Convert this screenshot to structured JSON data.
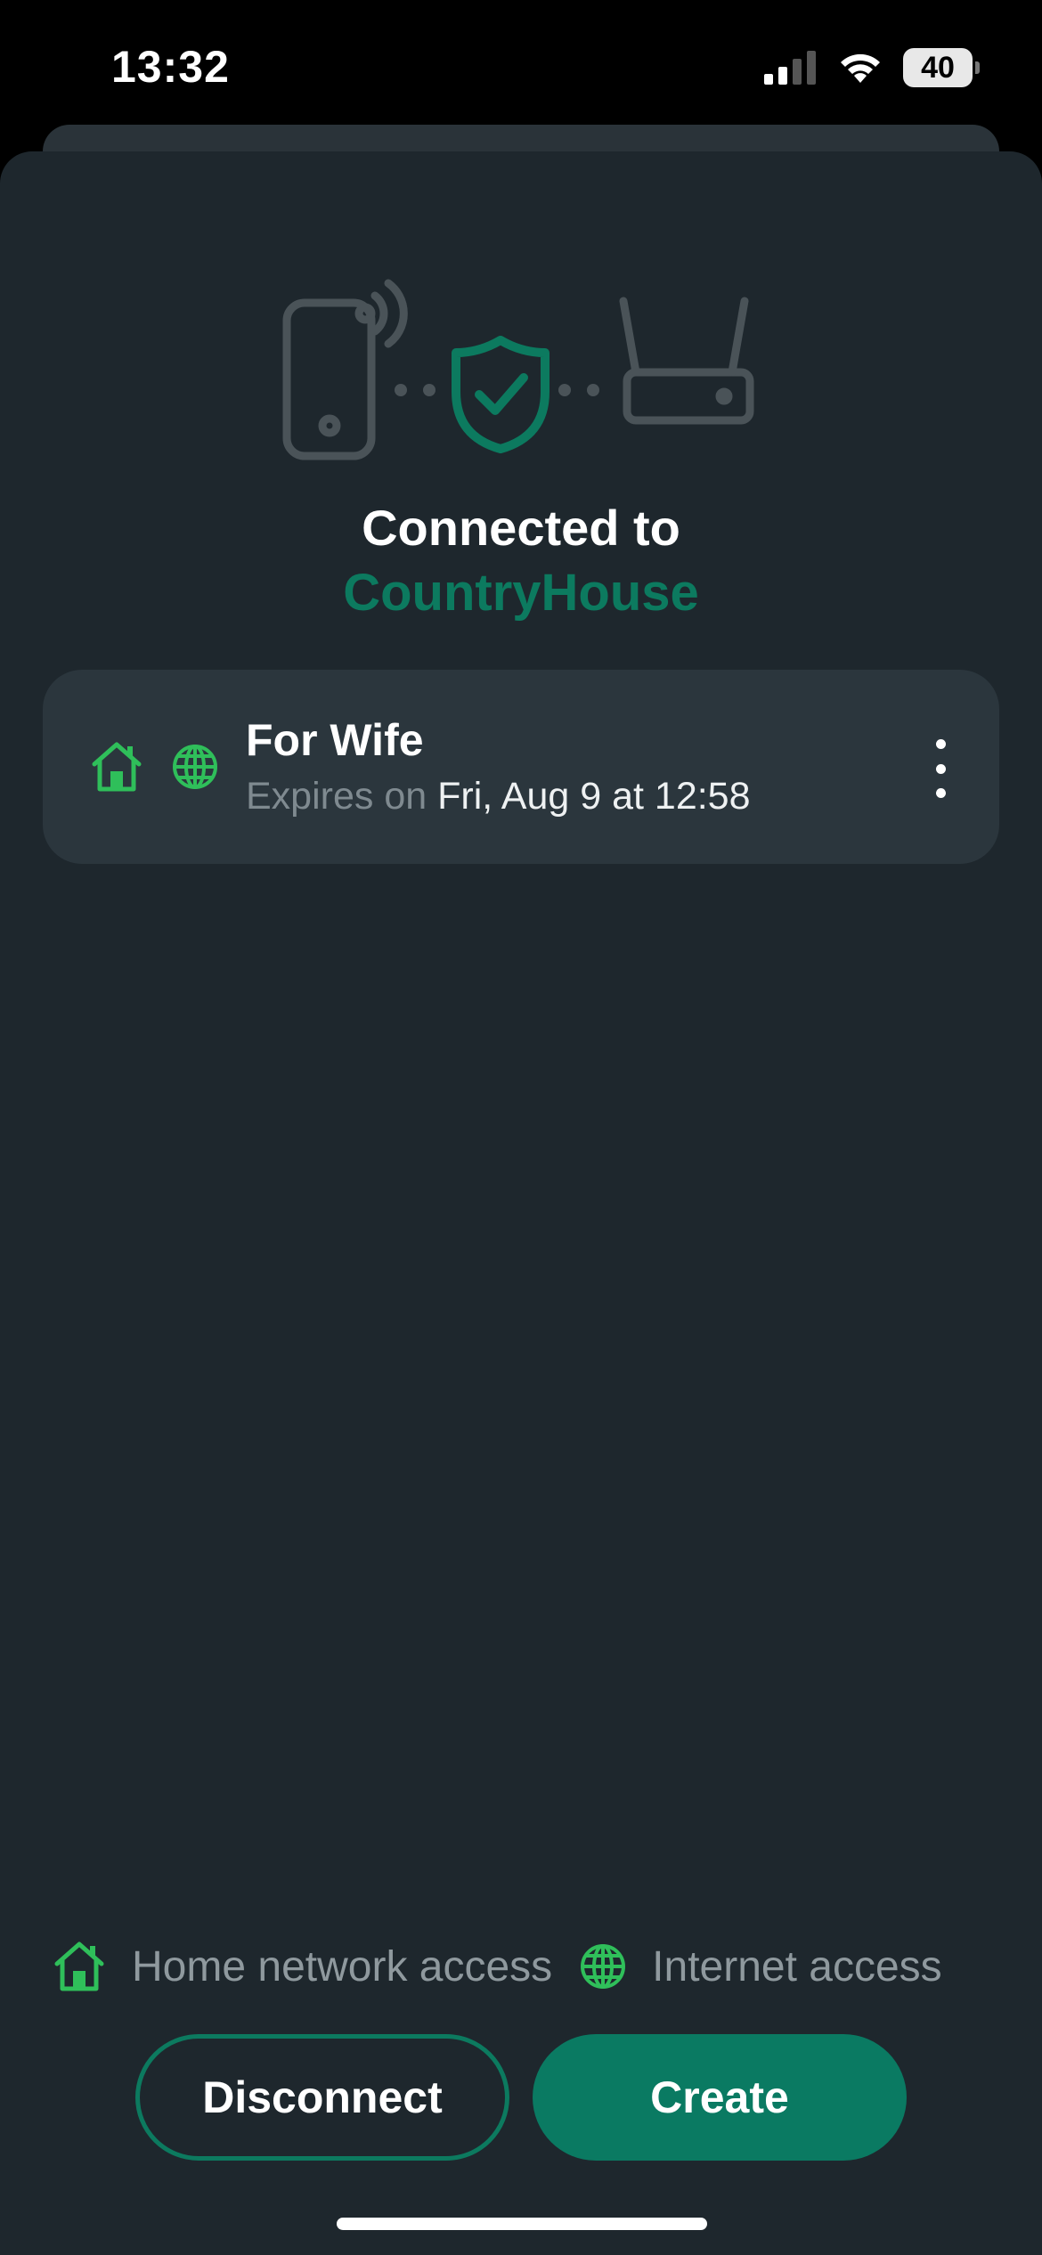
{
  "status_bar": {
    "time": "13:32",
    "battery": "40",
    "icons": [
      "cellular-signal-icon",
      "wifi-icon",
      "battery-icon"
    ]
  },
  "header": {
    "illustration_icons": [
      "phone-signal-icon",
      "shield-check-icon",
      "router-icon"
    ],
    "title": "Connected to",
    "network_name": "CountryHouse"
  },
  "invites": [
    {
      "name": "For Wife",
      "expires_prefix": "Expires on",
      "expires_value": "Fri, Aug 9 at 12:58",
      "icons": [
        "home-icon",
        "globe-icon"
      ],
      "menu_icon": "more-vertical-icon"
    }
  ],
  "legend": {
    "home_label": "Home network access",
    "internet_label": "Internet access"
  },
  "actions": {
    "disconnect_label": "Disconnect",
    "create_label": "Create"
  },
  "colors": {
    "background": "#1e272d",
    "card": "#2b363d",
    "accent": "#0a7a62",
    "icon_green": "#2fbf5a",
    "muted_text": "#8f999e"
  }
}
